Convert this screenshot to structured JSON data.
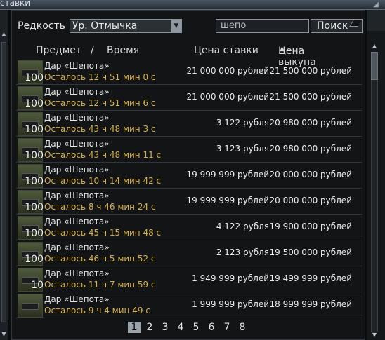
{
  "window": {
    "title": "ставки"
  },
  "filter": {
    "rarity_label": "Редкость",
    "rarity_value": "Ур. Отмычка"
  },
  "search": {
    "value": "шепо",
    "button_label": "Поиск"
  },
  "columns": {
    "item": "Предмет",
    "separator": "/",
    "time": "Время",
    "bid": "Цена ставки",
    "buyout": "Цена выкупа"
  },
  "rows": [
    {
      "qty": "100",
      "name": "Дар «Шепота»",
      "time": "Осталось 12 ч 51 мин 0 с",
      "bid": "21 000 000 рублей",
      "buyout": "21 500 000 рублей"
    },
    {
      "qty": "100",
      "name": "Дар «Шепота»",
      "time": "Осталось 12 ч 51 мин 6 с",
      "bid": "21 000 000 рублей",
      "buyout": "21 500 000 рублей"
    },
    {
      "qty": "100",
      "name": "Дар «Шепота»",
      "time": "Осталось 43 ч 48 мин 3 с",
      "bid": "3 122 рубля",
      "buyout": "20 980 000 рублей"
    },
    {
      "qty": "100",
      "name": "Дар «Шепота»",
      "time": "Осталось 43 ч 48 мин 11 с",
      "bid": "3 123 рубля",
      "buyout": "20 980 000 рублей"
    },
    {
      "qty": "100",
      "name": "Дар «Шепота»",
      "time": "Осталось 10 ч 14 мин 42 с",
      "bid": "19 999 999 рублей",
      "buyout": "20 000 000 рублей"
    },
    {
      "qty": "100",
      "name": "Дар «Шепота»",
      "time": "Осталось 8 ч 46 мин 24 с",
      "bid": "19 999 999 рублей",
      "buyout": "20 000 000 рублей"
    },
    {
      "qty": "100",
      "name": "Дар «Шепота»",
      "time": "Осталось 45 ч 15 мин 48 с",
      "bid": "4 122 рубля",
      "buyout": "19 900 000 рублей"
    },
    {
      "qty": "100",
      "name": "Дар «Шепота»",
      "time": "Осталось 46 ч 5 мин 52 с",
      "bid": "2 123 рубля",
      "buyout": "19 500 000 рублей"
    },
    {
      "qty": "10",
      "name": "Дар «Шепота»",
      "time": "Осталось 11 ч 7 мин 59 с",
      "bid": "1 949 999 рублей",
      "buyout": "19 499 999 рублей"
    },
    {
      "qty": "",
      "name": "Дар «Шепота»",
      "time": "Осталось 9 ч 4 мин 49 с",
      "bid": "1 999 999 рублей",
      "buyout": "18 999 999 рублей"
    }
  ],
  "pager": {
    "pages": [
      "1",
      "2",
      "3",
      "4",
      "5",
      "6",
      "7",
      "8"
    ],
    "active_page": "1"
  }
}
